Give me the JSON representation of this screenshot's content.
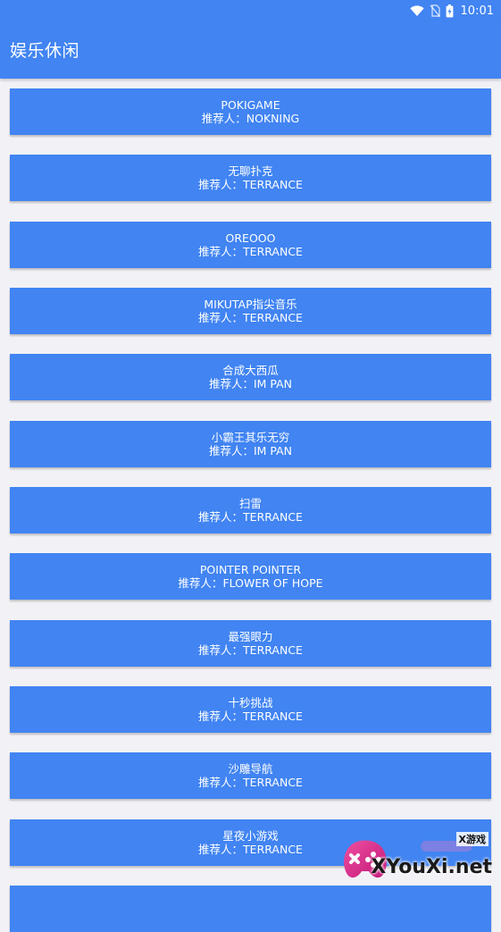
{
  "status_bar": {
    "time": "10:01",
    "icons": [
      "wifi-icon",
      "no-sim-icon",
      "battery-charging-icon"
    ]
  },
  "app_bar": {
    "title": "娱乐休闲"
  },
  "items": [
    {
      "title": "POKIGAME",
      "recommender_label": "推荐人：",
      "recommender": "NOKNING"
    },
    {
      "title": "无聊扑克",
      "recommender_label": "推荐人：",
      "recommender": "TERRANCE"
    },
    {
      "title": "OREOOO",
      "recommender_label": "推荐人：",
      "recommender": "TERRANCE"
    },
    {
      "title": "MIKUTAP指尖音乐",
      "recommender_label": "推荐人：",
      "recommender": "TERRANCE"
    },
    {
      "title": "合成大西瓜",
      "recommender_label": "推荐人：",
      "recommender": "IM PAN"
    },
    {
      "title": "小霸王其乐无穷",
      "recommender_label": "推荐人：",
      "recommender": "IM PAN"
    },
    {
      "title": "扫雷",
      "recommender_label": "推荐人：",
      "recommender": "TERRANCE"
    },
    {
      "title": "POINTER POINTER",
      "recommender_label": "推荐人：",
      "recommender": "FLOWER OF HOPE"
    },
    {
      "title": "最强眼力",
      "recommender_label": "推荐人：",
      "recommender": "TERRANCE"
    },
    {
      "title": "十秒挑战",
      "recommender_label": "推荐人：",
      "recommender": "TERRANCE"
    },
    {
      "title": "沙雕导航",
      "recommender_label": "推荐人：",
      "recommender": "TERRANCE"
    },
    {
      "title": "星夜小游戏",
      "recommender_label": "推荐人：",
      "recommender": "TERRANCE"
    },
    {
      "title": "",
      "recommender_label": "",
      "recommender": ""
    }
  ],
  "watermark": {
    "tag": "X游戏",
    "text": "XYouXi.net"
  },
  "colors": {
    "primary": "#4184f2",
    "background": "#f2f1f6",
    "text_on_primary": "#ffffff"
  }
}
